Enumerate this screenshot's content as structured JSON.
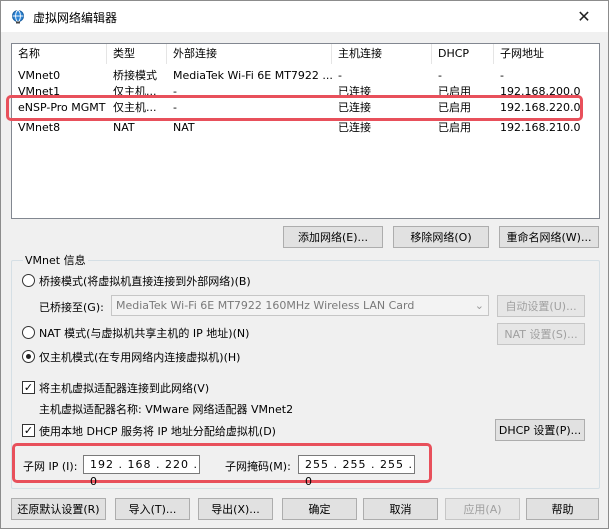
{
  "window": {
    "title": "虚拟网络编辑器",
    "close_glyph": "✕"
  },
  "network_table": {
    "columns": [
      "名称",
      "类型",
      "外部连接",
      "主机连接",
      "DHCP",
      "子网地址"
    ],
    "rows": [
      {
        "name": "VMnet0",
        "type": "桥接模式",
        "external": "MediaTek Wi-Fi 6E MT7922 ...",
        "host": "-",
        "dhcp": "-",
        "subnet": "-"
      },
      {
        "name": "VMnet1",
        "type": "仅主机...",
        "external": "-",
        "host": "已连接",
        "dhcp": "已启用",
        "subnet": "192.168.200.0"
      },
      {
        "name": "eNSP-Pro MGMT",
        "type": "仅主机...",
        "external": "-",
        "host": "已连接",
        "dhcp": "已启用",
        "subnet": "192.168.220.0"
      },
      {
        "name": "VMnet8",
        "type": "NAT",
        "external": "NAT",
        "host": "已连接",
        "dhcp": "已启用",
        "subnet": "192.168.210.0"
      }
    ]
  },
  "table_buttons": {
    "add": "添加网络(E)...",
    "remove": "移除网络(O)",
    "rename": "重命名网络(W)..."
  },
  "vmnet_info": {
    "title": "VMnet 信息",
    "bridged_label": "桥接模式(将虚拟机直接连接到外部网络)(B)",
    "bridged_to_label": "已桥接至(G):",
    "bridged_to_value": "MediaTek Wi-Fi 6E MT7922 160MHz Wireless LAN Card",
    "auto_settings": "自动设置(U)...",
    "nat_label": "NAT 模式(与虚拟机共享主机的 IP 地址)(N)",
    "nat_settings": "NAT 设置(S)...",
    "hostonly_label": "仅主机模式(在专用网络内连接虚拟机)(H)",
    "selected_mode": "hostonly",
    "connect_adapter_label": "将主机虚拟适配器连接到此网络(V)",
    "adapter_name_label": "主机虚拟适配器名称: VMware 网络适配器 VMnet2",
    "dhcp_label": "使用本地 DHCP 服务将 IP 地址分配给虚拟机(D)",
    "dhcp_settings": "DHCP 设置(P)...",
    "subnet_ip_label": "子网 IP (I):",
    "subnet_ip_value": "192 . 168 . 220 .  0",
    "subnet_mask_label": "子网掩码(M):",
    "subnet_mask_value": "255 . 255 . 255 .  0"
  },
  "footer_buttons": {
    "restore": "还原默认设置(R)",
    "import": "导入(T)...",
    "export": "导出(X)...",
    "ok": "确定",
    "cancel": "取消",
    "apply": "应用(A)",
    "help": "帮助"
  },
  "colors": {
    "highlight": "#e8505b",
    "window_bg": "#f0f0f0"
  }
}
